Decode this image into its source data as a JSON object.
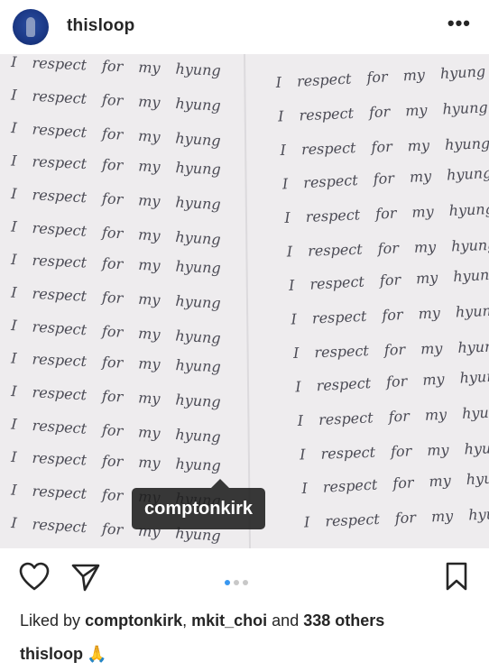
{
  "post": {
    "username": "thisloop",
    "more_icon": "more-horizontal-icon",
    "more_label": "•••"
  },
  "photo": {
    "description_text_lines_left": [
      "I respect for my hyung",
      "I respect for my hyung",
      "I respect for my hyung",
      "I respect for my hyung",
      "I respect for my hyung",
      "I respect for my hyung",
      "I respect for my hyung",
      "I respect for my hyung",
      "I respect for my hyung",
      "I respect for my hyung",
      "I respect for my hyung",
      "I respect for my hyung",
      "I respect for my hyung",
      "I respect for my hyung",
      "I respect for my hyung",
      "I respect for my hyung"
    ],
    "description_text_lines_right": [
      "I respect for my hyung",
      "I respect for my hyung",
      "I respect for my hyung",
      "I respect for my hyung",
      "I respect for my hyung",
      "I respect for my hyung",
      "I respect for my hyung",
      "I respect for my hyung",
      "I respect for my hyung",
      "I respect for my hyung",
      "I respect for my hyung",
      "I respect for my hyung",
      "I respect for my hyung",
      "I respect for my hyung"
    ],
    "tag_label": "comptonkirk"
  },
  "actions": {
    "like_icon": "heart-icon",
    "share_icon": "paper-plane-icon",
    "save_icon": "bookmark-icon",
    "carousel_count": 3,
    "carousel_active": 0
  },
  "likes": {
    "prefix": "Liked by",
    "user1": "comptonkirk",
    "separator": ",",
    "user2": "mkit_choi",
    "and_text": "and",
    "others": "338 others"
  },
  "caption": {
    "username": "thisloop",
    "emoji": "🙏"
  },
  "colors": {
    "accent_blue": "#3897f0",
    "text": "#262626",
    "paper": "#eceaec",
    "ink": "#4b4b55"
  }
}
